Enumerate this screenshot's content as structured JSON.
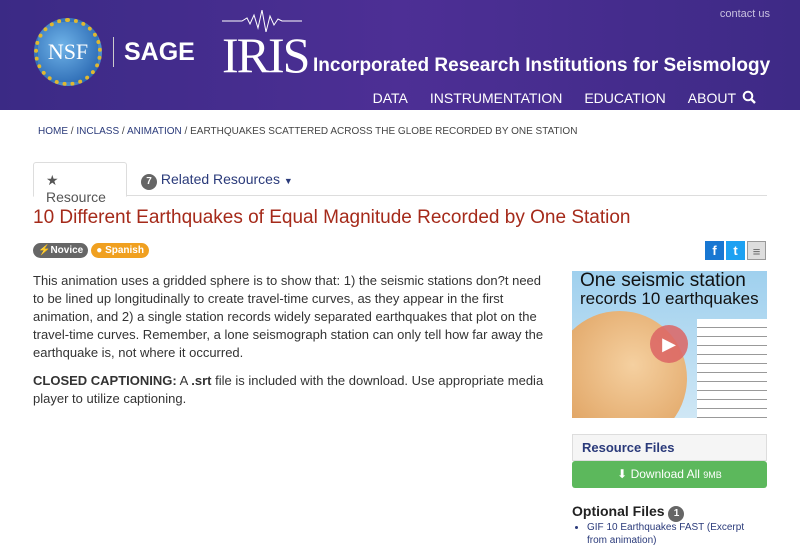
{
  "header": {
    "contact": "contact us",
    "nsf": "NSF",
    "sage": "SAGE",
    "iris": "IRIS",
    "org": "Incorporated Research Institutions for Seismology",
    "nav": [
      "DATA",
      "INSTRUMENTATION",
      "EDUCATION",
      "ABOUT"
    ]
  },
  "breadcrumb": [
    "HOME",
    "INCLASS",
    "ANIMATION",
    "EARTHQUAKES SCATTERED ACROSS THE GLOBE RECORDED BY ONE STATION"
  ],
  "tabs": {
    "resource": "Resource",
    "related_count": "7",
    "related": "Related Resources"
  },
  "title": "10 Different Earthquakes of Equal Magnitude Recorded by One Station",
  "pills": {
    "novice": "Novice",
    "spanish": "Spanish"
  },
  "description": "This animation uses a gridded sphere is to show that: 1) the seismic stations don?t need to be lined up longitudinally to create travel-time curves, as they appear in the first animation, and 2) a single station records widely separated earthquakes that plot on the travel-time curves. Remember, a lone seismograph station can only tell how far away the earthquake is, not where it occurred.",
  "captioning": {
    "label": "CLOSED CAPTIONING:",
    "a": "A",
    "srt": ".srt",
    "rest": "file is included with the download. Use appropriate media player to utilize captioning."
  },
  "thumbnail": {
    "line1": "One seismic station",
    "line2": "records 10 earthquakes"
  },
  "resource_files": {
    "title": "Resource Files",
    "download": "Download All",
    "size": "9MB"
  },
  "optional": {
    "title": "Optional Files",
    "count": "1",
    "items": [
      "GIF 10 Earthquakes FAST (Excerpt from animation)"
    ]
  }
}
